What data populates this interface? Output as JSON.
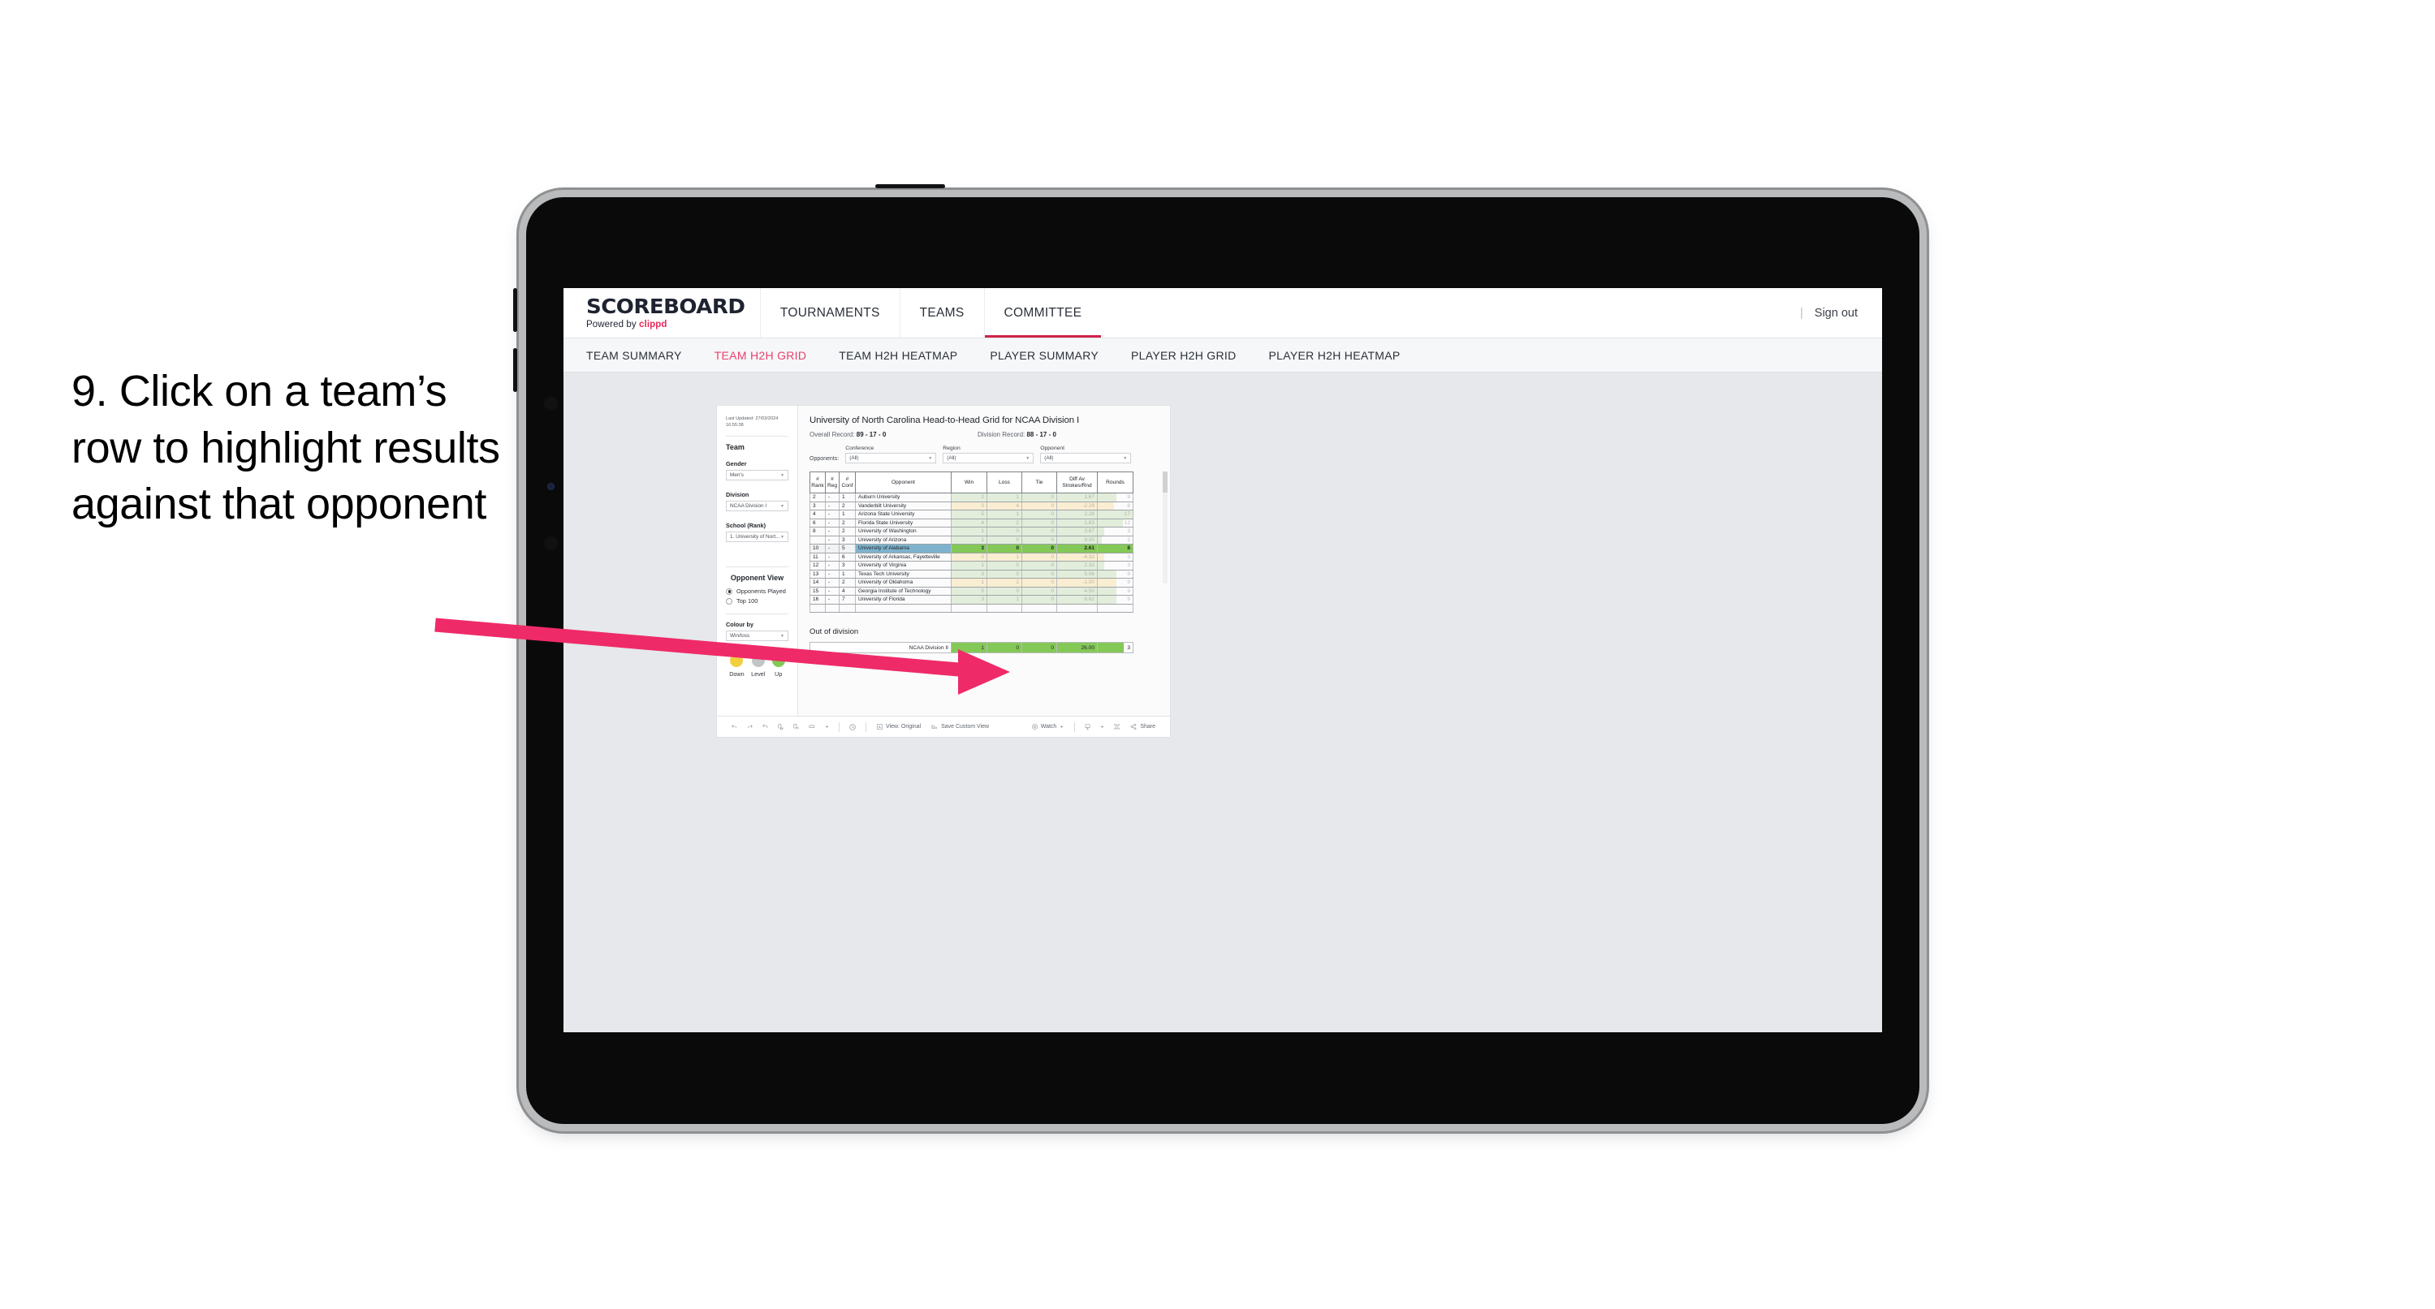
{
  "annotation": {
    "text": "9. Click on a team’s row to highlight results against that opponent",
    "arrow_color": "#ef2a68"
  },
  "app": {
    "brand": {
      "name": "SCOREBOARD",
      "powered_prefix": "Powered by ",
      "powered_brand": "clippd"
    },
    "nav": [
      {
        "label": "TOURNAMENTS",
        "active": false
      },
      {
        "label": "TEAMS",
        "active": false
      },
      {
        "label": "COMMITTEE",
        "active": true
      }
    ],
    "topbar_right": {
      "divider": "|",
      "sign_out": "Sign out"
    },
    "subnav": [
      {
        "label": "TEAM SUMMARY",
        "active": false
      },
      {
        "label": "TEAM H2H GRID",
        "active": true
      },
      {
        "label": "TEAM H2H HEATMAP",
        "active": false
      },
      {
        "label": "PLAYER SUMMARY",
        "active": false
      },
      {
        "label": "PLAYER H2H GRID",
        "active": false
      },
      {
        "label": "PLAYER H2H HEATMAP",
        "active": false
      }
    ]
  },
  "panel": {
    "last_updated": "Last Updated: 27/03/2024 16:55:38",
    "team_heading": "Team",
    "gender": {
      "label": "Gender",
      "value": "Men’s"
    },
    "division": {
      "label": "Division",
      "value": "NCAA Division I"
    },
    "school": {
      "label": "School (Rank)",
      "value": "1. University of Nort..."
    },
    "opponent_view": {
      "heading": "Opponent View",
      "options": [
        {
          "label": "Opponents Played",
          "selected": true
        },
        {
          "label": "Top 100",
          "selected": false
        }
      ]
    },
    "colour_by": {
      "label": "Colour by",
      "value": "Win/loss"
    },
    "legend": [
      {
        "label": "Down",
        "color": "#f2cf3f"
      },
      {
        "label": "Level",
        "color": "#c1c5c8"
      },
      {
        "label": "Up",
        "color": "#84c857"
      }
    ]
  },
  "viz": {
    "title": "University of North Carolina Head-to-Head Grid for NCAA Division I",
    "overall_record_label": "Overall Record: ",
    "overall_record_value": "89 - 17 - 0",
    "division_record_label": "Division Record: ",
    "division_record_value": "88 - 17 - 0",
    "opponents_label": "Opponents:",
    "filters": [
      {
        "caption": "Conference",
        "value": "(All)"
      },
      {
        "caption": "Region",
        "value": "(All)"
      },
      {
        "caption": "Opponent",
        "value": "(All)"
      }
    ],
    "table": {
      "headers": [
        "# Rank",
        "# Reg",
        "# Conf",
        "Opponent",
        "Win",
        "Loss",
        "Tie",
        "Diff Av Strokes/Rnd",
        "Rounds"
      ],
      "rows": [
        {
          "rank": "2",
          "reg": "-",
          "conf": "1",
          "opponent": "Auburn University",
          "win": "2",
          "loss": "1",
          "tie": "0",
          "diff": "1.67",
          "rounds": "9",
          "state": "up",
          "bar_pct": 53,
          "highlight": false
        },
        {
          "rank": "3",
          "reg": "-",
          "conf": "2",
          "opponent": "Vanderbilt University",
          "win": "0",
          "loss": "4",
          "tie": "0",
          "diff": "-2.29",
          "rounds": "8",
          "state": "down",
          "bar_pct": 47,
          "highlight": false
        },
        {
          "rank": "4",
          "reg": "-",
          "conf": "1",
          "opponent": "Arizona State University",
          "win": "5",
          "loss": "1",
          "tie": "0",
          "diff": "2.28",
          "rounds": "17",
          "state": "up",
          "bar_pct": 100,
          "highlight": false
        },
        {
          "rank": "6",
          "reg": "-",
          "conf": "2",
          "opponent": "Florida State University",
          "win": "4",
          "loss": "2",
          "tie": "0",
          "diff": "1.83",
          "rounds": "12",
          "state": "up",
          "bar_pct": 71,
          "highlight": false
        },
        {
          "rank": "8",
          "reg": "-",
          "conf": "2",
          "opponent": "University of Washington",
          "win": "1",
          "loss": "0",
          "tie": "0",
          "diff": "3.67",
          "rounds": "3",
          "state": "up",
          "bar_pct": 18,
          "highlight": false
        },
        {
          "rank": "",
          "reg": "-",
          "conf": "3",
          "opponent": "University of Arizona",
          "win": "1",
          "loss": "0",
          "tie": "0",
          "diff": "9.00",
          "rounds": "2",
          "state": "up",
          "bar_pct": 12,
          "highlight": false
        },
        {
          "rank": "10",
          "reg": "-",
          "conf": "5",
          "opponent": "University of Alabama",
          "win": "3",
          "loss": "0",
          "tie": "0",
          "diff": "2.61",
          "rounds": "8",
          "state": "up",
          "bar_pct": 47,
          "highlight": true
        },
        {
          "rank": "11",
          "reg": "-",
          "conf": "6",
          "opponent": "University of Arkansas, Fayetteville",
          "win": "0",
          "loss": "1",
          "tie": "0",
          "diff": "-4.33",
          "rounds": "3",
          "state": "down",
          "bar_pct": 18,
          "highlight": false
        },
        {
          "rank": "12",
          "reg": "-",
          "conf": "3",
          "opponent": "University of Virginia",
          "win": "1",
          "loss": "0",
          "tie": "0",
          "diff": "2.33",
          "rounds": "3",
          "state": "up",
          "bar_pct": 18,
          "highlight": false
        },
        {
          "rank": "13",
          "reg": "-",
          "conf": "1",
          "opponent": "Texas Tech University",
          "win": "3",
          "loss": "0",
          "tie": "0",
          "diff": "5.56",
          "rounds": "9",
          "state": "up",
          "bar_pct": 53,
          "highlight": false
        },
        {
          "rank": "14",
          "reg": "-",
          "conf": "2",
          "opponent": "University of Oklahoma",
          "win": "1",
          "loss": "2",
          "tie": "0",
          "diff": "-1.00",
          "rounds": "9",
          "state": "down",
          "bar_pct": 53,
          "highlight": false
        },
        {
          "rank": "15",
          "reg": "-",
          "conf": "4",
          "opponent": "Georgia Institute of Technology",
          "win": "5",
          "loss": "0",
          "tie": "0",
          "diff": "4.50",
          "rounds": "9",
          "state": "up",
          "bar_pct": 53,
          "highlight": false
        },
        {
          "rank": "16",
          "reg": "-",
          "conf": "7",
          "opponent": "University of Florida",
          "win": "3",
          "loss": "1",
          "tie": "0",
          "diff": "6.62",
          "rounds": "9",
          "state": "up",
          "bar_pct": 53,
          "highlight": false
        }
      ]
    },
    "out_of_division": {
      "heading": "Out of division",
      "row": {
        "label": "NCAA Division II",
        "win": "1",
        "loss": "0",
        "tie": "0",
        "diff": "26.00",
        "rounds": "3"
      }
    }
  },
  "toolbar": {
    "left_icons": [
      "undo-icon",
      "redo-icon",
      "revert-icon",
      "refresh-icon",
      "pause-icon",
      "flow-icon",
      "caret-down-icon"
    ],
    "clock_icon": "clock-icon",
    "view_label": "View: Original",
    "save_label": "Save Custom View",
    "watch_label": "Watch",
    "download_icon": "download-icon",
    "fullscreen_icon": "fullscreen-icon",
    "share_label": "Share"
  },
  "colors": {
    "accent_pink": "#e8416f",
    "nav_underline": "#d0234a",
    "up_green": "#84c857",
    "down_yellow": "#f2cf3f",
    "level_grey": "#c1c5c8",
    "highlight_blue": "#7eb2cc",
    "tint_green": "#e2eedb",
    "tint_yellow": "#faeed2"
  }
}
